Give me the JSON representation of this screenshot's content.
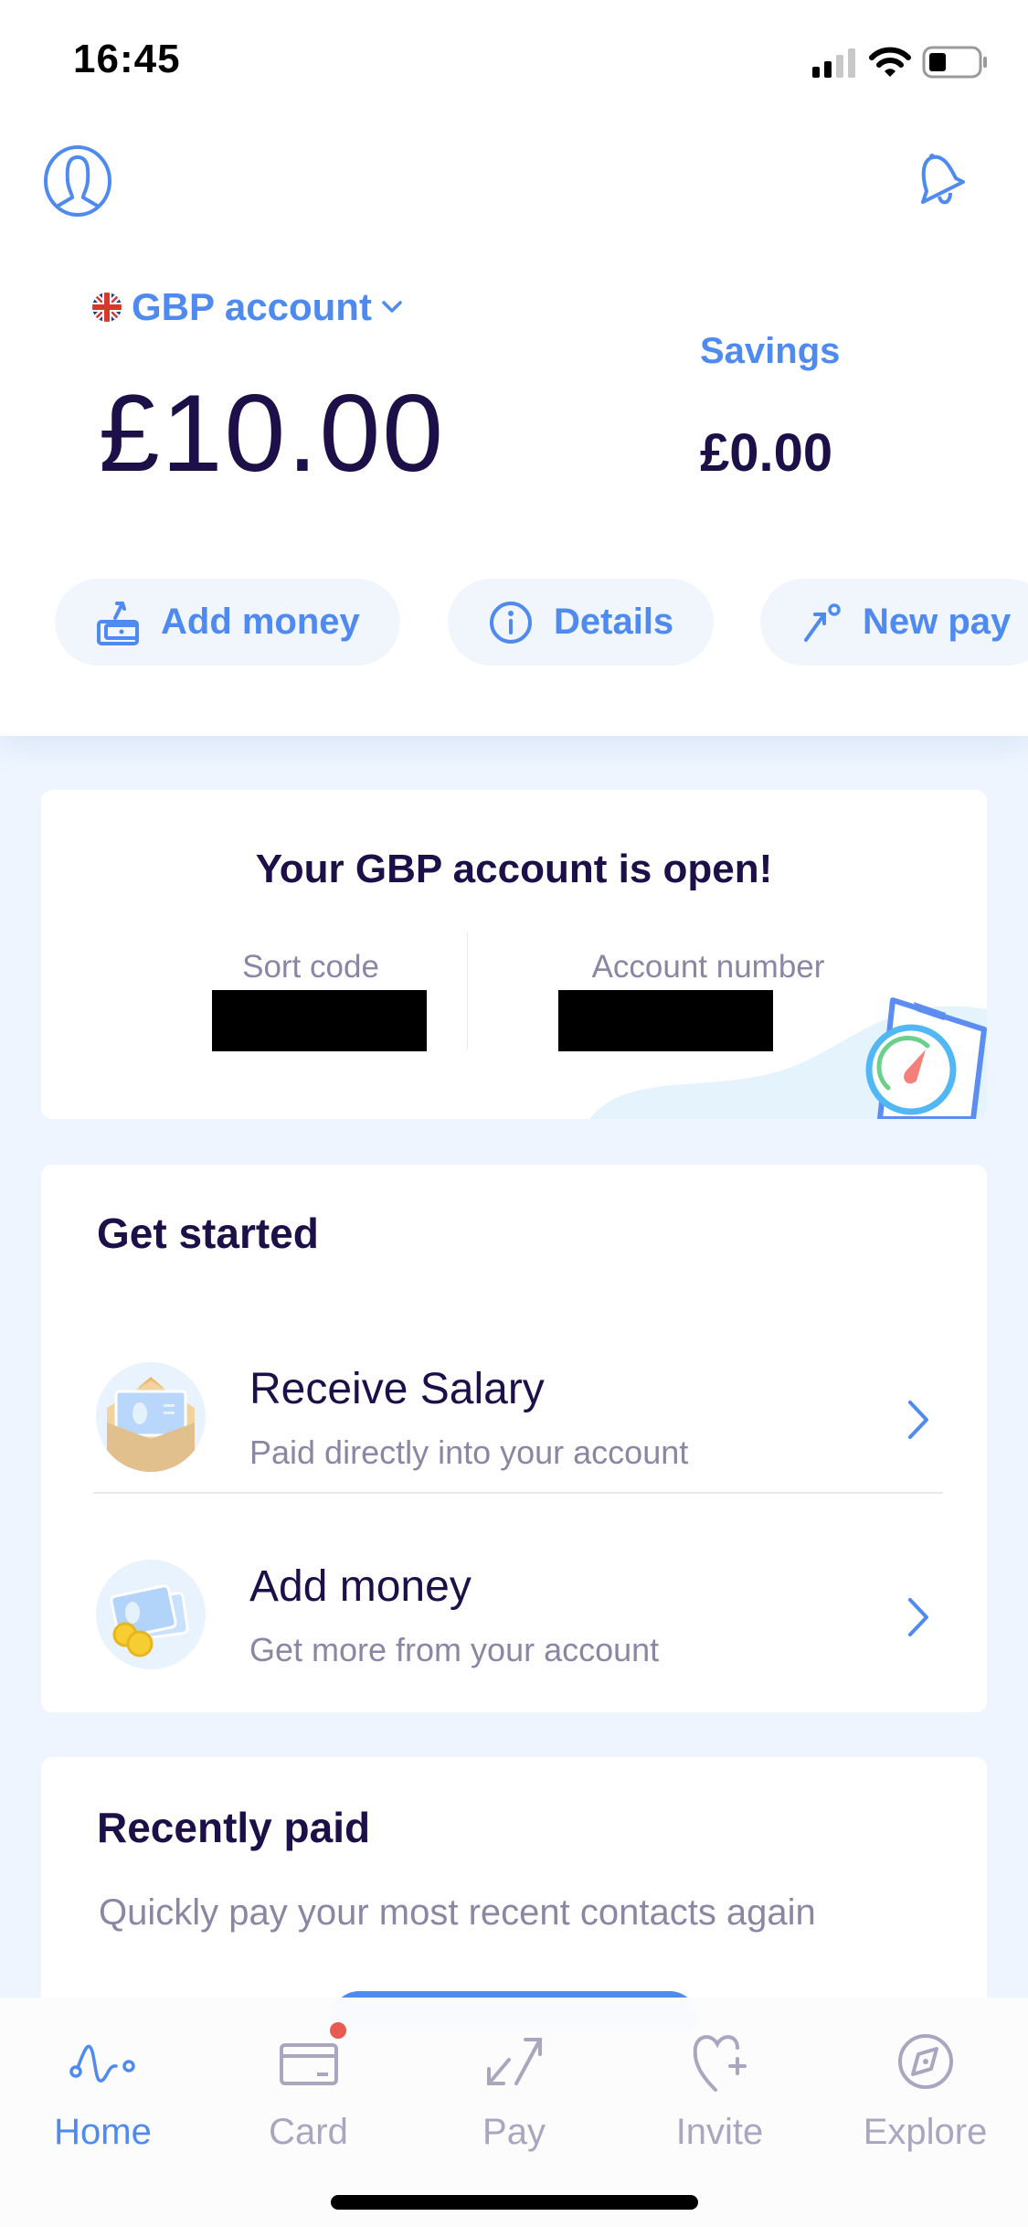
{
  "status_bar": {
    "time": "16:45",
    "icons": [
      "cellular-signal-icon",
      "wifi-icon",
      "battery-icon"
    ]
  },
  "header": {
    "profile_icon": "profile-icon",
    "notifications_icon": "bell-icon",
    "account": {
      "flag": "uk-flag-icon",
      "label": "GBP account",
      "dropdown_icon": "chevron-down-icon",
      "balance": "£10.00"
    },
    "savings": {
      "label": "Savings",
      "balance": "£0.00"
    },
    "actions": [
      {
        "label": "Add money",
        "icon": "add-money-icon"
      },
      {
        "label": "Details",
        "icon": "info-icon"
      },
      {
        "label": "New pay",
        "icon": "new-payment-icon"
      }
    ]
  },
  "account_open_card": {
    "title": "Your GBP account is open!",
    "sort_code_label": "Sort code",
    "sort_code_value": "[redacted]",
    "account_number_label": "Account number",
    "account_number_value": "[redacted]"
  },
  "get_started": {
    "title": "Get started",
    "items": [
      {
        "title": "Receive Salary",
        "subtitle": "Paid directly into your account",
        "icon": "envelope-salary-icon"
      },
      {
        "title": "Add money",
        "subtitle": "Get more from your account",
        "icon": "card-coins-icon"
      }
    ]
  },
  "recently_paid": {
    "title": "Recently paid",
    "subtitle": "Quickly pay your most recent contacts again"
  },
  "tab_bar": {
    "active": "Home",
    "tabs": [
      {
        "label": "Home",
        "icon": "home-wave-icon",
        "badge": false
      },
      {
        "label": "Card",
        "icon": "card-icon",
        "badge": true
      },
      {
        "label": "Pay",
        "icon": "pay-arrows-icon",
        "badge": false
      },
      {
        "label": "Invite",
        "icon": "heart-plus-icon",
        "badge": false
      },
      {
        "label": "Explore",
        "icon": "compass-icon",
        "badge": false
      }
    ]
  },
  "colors": {
    "accent": "#4F8AF0",
    "text_dark": "#1D0F48",
    "muted": "#8C86A4",
    "background": "#EEF5FE",
    "badge": "#E85B52",
    "tab_inactive": "#ABA6BF"
  }
}
